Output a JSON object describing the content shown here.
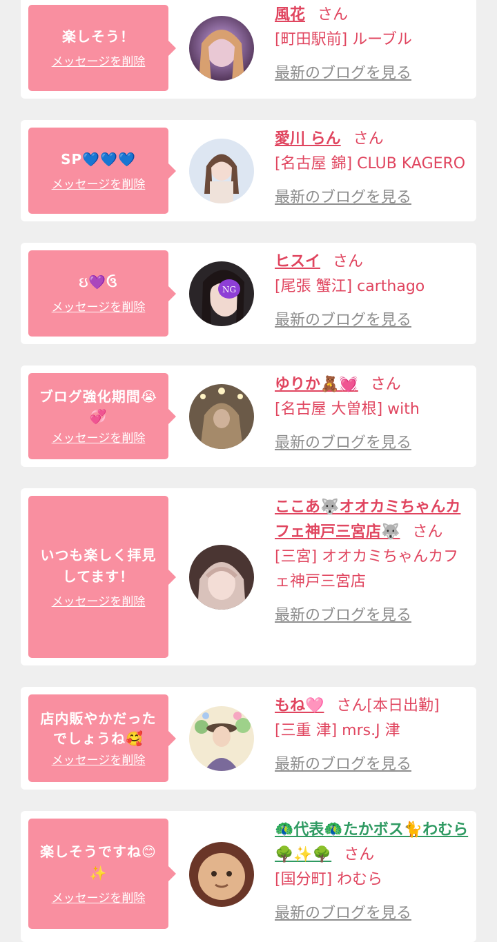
{
  "delete_label": "メッセージを削除",
  "blog_label": "最新のブログを見る",
  "honorific": "さん",
  "items": [
    {
      "message": "楽しそう！",
      "name": "風花",
      "shop": "[町田駅前] ルーブル",
      "avatar_icon": "avatar-photo"
    },
    {
      "message": "SP💙💙💙",
      "name": "愛川 らん",
      "shop": "[名古屋 錦] CLUB KAGERO",
      "avatar_icon": "avatar-photo"
    },
    {
      "message": "ઇ💜ઉ",
      "name": "ヒスイ",
      "shop": "[尾張 蟹江] carthago",
      "avatar_icon": "avatar-photo"
    },
    {
      "message": "ブログ強化期間😭💞",
      "name": "ゆりか🧸💓",
      "shop": "[名古屋 大曽根] with",
      "avatar_icon": "avatar-photo"
    },
    {
      "message": "いつも楽しく拝見してます！",
      "name": "ここあ🐺オオカミちゃんカフェ神戸三宮店🐺",
      "shop": "[三宮] オオカミちゃんカフェ神戸三宮店",
      "avatar_icon": "avatar-photo"
    },
    {
      "message": "店内販やかだったでしょうね🥰",
      "name": "もね🩷",
      "name_suffix": "[本日出勤]",
      "shop": "[三重 津] mrs.J 津",
      "avatar_icon": "avatar-illustration"
    },
    {
      "message": "楽しそうですね😊✨",
      "name": "🦚代表🦚たかボス🐈わむら🌳✨🌳",
      "shop": "[国分町] わむら",
      "avatar_icon": "avatar-photo"
    }
  ],
  "colors": {
    "accent": "#e0455f",
    "bubble": "#f98fa0",
    "background": "#efefef",
    "link_gray": "#8e8e8e"
  }
}
